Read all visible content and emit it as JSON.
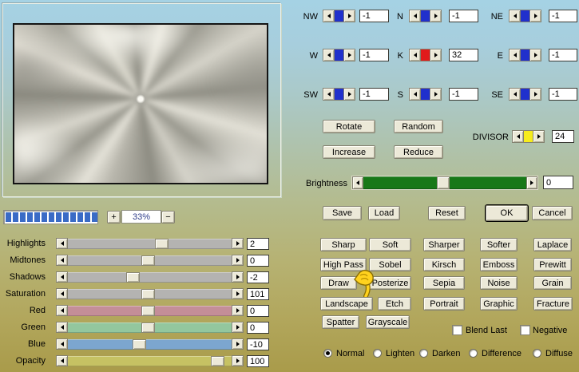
{
  "preview": {
    "zoom_percent": "33%",
    "zoom_in": "+",
    "zoom_out": "−",
    "progress_segments": 13
  },
  "kernel": {
    "cells": [
      {
        "label": "NW",
        "value": "-1",
        "bar": "#2030cc"
      },
      {
        "label": "N",
        "value": "-1",
        "bar": "#2030cc"
      },
      {
        "label": "NE",
        "value": "-1",
        "bar": "#2030cc"
      },
      {
        "label": "W",
        "value": "-1",
        "bar": "#2030cc"
      },
      {
        "label": "K",
        "value": "32",
        "bar": "#e11b1b"
      },
      {
        "label": "E",
        "value": "-1",
        "bar": "#2030cc"
      },
      {
        "label": "SW",
        "value": "-1",
        "bar": "#2030cc"
      },
      {
        "label": "S",
        "value": "-1",
        "bar": "#2030cc"
      },
      {
        "label": "SE",
        "value": "-1",
        "bar": "#2030cc"
      }
    ]
  },
  "actions": {
    "rotate": "Rotate",
    "random": "Random",
    "increase": "Increase",
    "reduce": "Reduce"
  },
  "divisor": {
    "label": "DIVISOR",
    "value": "24",
    "bar": "#f6ec1c"
  },
  "brightness": {
    "label": "Brightness",
    "value": "0",
    "fraction": 0.49,
    "track": "#187818"
  },
  "file_actions": {
    "save": "Save",
    "load": "Load",
    "reset": "Reset",
    "ok": "OK",
    "cancel": "Cancel"
  },
  "filters": {
    "rows": [
      [
        "Sharp",
        "Soft",
        "Sharper",
        "Softer",
        "Laplace"
      ],
      [
        "High Pass",
        "Sobel",
        "Kirsch",
        "Emboss",
        "Prewitt"
      ],
      [
        "Draw",
        "Posterize",
        "Sepia",
        "Noise",
        "Grain"
      ],
      [
        "Landscape",
        "Etch",
        "Portrait",
        "Graphic",
        "Fracture"
      ],
      [
        "Spatter",
        "Grayscale"
      ]
    ]
  },
  "options": {
    "blend_last": {
      "label": "Blend Last",
      "checked": false
    },
    "negative": {
      "label": "Negative",
      "checked": false
    },
    "modes": [
      {
        "label": "Normal",
        "selected": true
      },
      {
        "label": "Lighten",
        "selected": false
      },
      {
        "label": "Darken",
        "selected": false
      },
      {
        "label": "Difference",
        "selected": false
      },
      {
        "label": "Diffuse",
        "selected": false
      }
    ]
  },
  "adjustments": {
    "sliders": [
      {
        "label": "Highlights",
        "value": "2",
        "fraction": 0.58,
        "track": "#b4b3b1"
      },
      {
        "label": "Midtones",
        "value": "0",
        "fraction": 0.49,
        "track": "#b4b3b1"
      },
      {
        "label": "Shadows",
        "value": "-2",
        "fraction": 0.39,
        "track": "#b4b3b1"
      },
      {
        "label": "Saturation",
        "value": "101",
        "fraction": 0.49,
        "track": "#b4b3b1"
      },
      {
        "label": "Red",
        "value": "0",
        "fraction": 0.49,
        "track": "#c48e98"
      },
      {
        "label": "Green",
        "value": "0",
        "fraction": 0.49,
        "track": "#93c79e"
      },
      {
        "label": "Blue",
        "value": "-10",
        "fraction": 0.43,
        "track": "#7ca6cf"
      },
      {
        "label": "Opacity",
        "value": "100",
        "fraction": 0.95,
        "track": "#c6c263"
      }
    ]
  }
}
